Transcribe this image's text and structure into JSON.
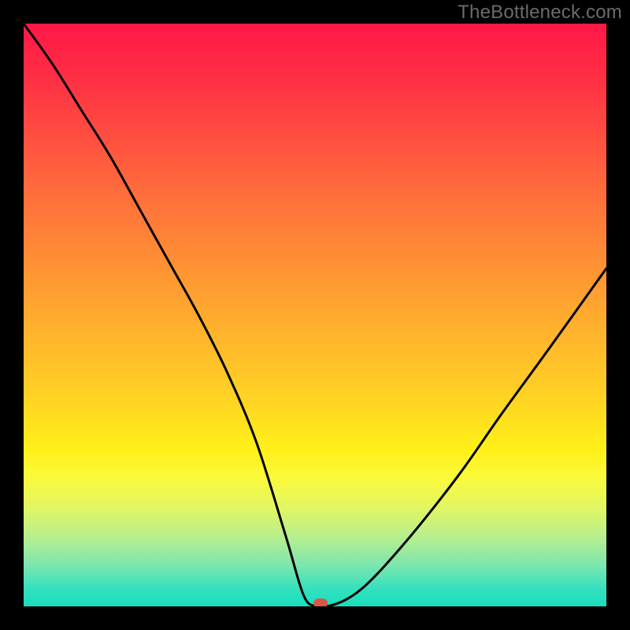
{
  "watermark": {
    "text": "TheBottleneck.com"
  },
  "chart_data": {
    "type": "line",
    "title": "",
    "xlabel": "",
    "ylabel": "",
    "xlim": [
      0,
      100
    ],
    "ylim": [
      0,
      100
    ],
    "grid": false,
    "legend": false,
    "colors": {
      "gradient_top": "#ff1846",
      "gradient_mid": "#ffe41e",
      "gradient_bottom": "#18debf",
      "curve": "#000000",
      "marker": "#d9574a",
      "frame": "#000000"
    },
    "series": [
      {
        "name": "bottleneck-curve",
        "x": [
          0,
          5,
          10,
          15,
          20,
          25,
          30,
          35,
          40,
          45,
          48,
          50,
          52,
          55,
          58,
          62,
          68,
          75,
          82,
          90,
          100
        ],
        "y": [
          100,
          93,
          85,
          77,
          68,
          59,
          50,
          40,
          28,
          12,
          2,
          0,
          0,
          1,
          3,
          7,
          14,
          23,
          33,
          44,
          58
        ]
      }
    ],
    "marker": {
      "x": 51,
      "y": 0.5
    }
  }
}
